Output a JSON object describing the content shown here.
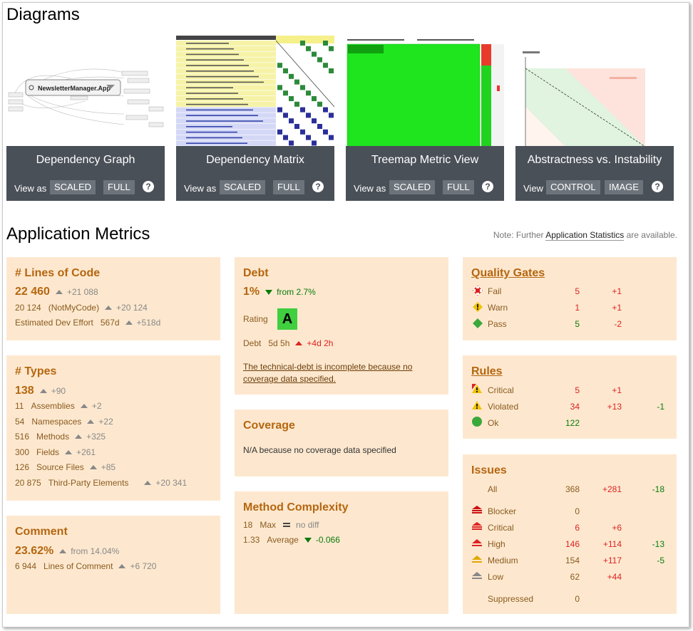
{
  "sections": {
    "diagrams_title": "Diagrams",
    "metrics_title": "Application Metrics"
  },
  "note": {
    "prefix": "Note: Further ",
    "link": "Application Statistics",
    "suffix": " are available."
  },
  "diagrams": [
    {
      "title": "Dependency Graph",
      "view_label": "View as",
      "btn1": "SCALED",
      "btn2": "FULL",
      "help": "?",
      "thumb_label": "NewsletterManager.App"
    },
    {
      "title": "Dependency Matrix",
      "view_label": "View as",
      "btn1": "SCALED",
      "btn2": "FULL",
      "help": "?"
    },
    {
      "title": "Treemap Metric View",
      "view_label": "View as",
      "btn1": "SCALED",
      "btn2": "FULL",
      "help": "?"
    },
    {
      "title": "Abstractness vs. Instability",
      "view_label": "View",
      "btn1": "CONTROL",
      "btn2": "IMAGE",
      "help": "?"
    }
  ],
  "loc": {
    "title": "# Lines of Code",
    "value": "22 460",
    "delta": "+21 088",
    "notmycode_value": "20 124",
    "notmycode_label": "(NotMyCode)",
    "notmycode_delta": "+20 124",
    "effort_label": "Estimated Dev Effort",
    "effort_value": "567d",
    "effort_delta": "+518d"
  },
  "types": {
    "title": "# Types",
    "value": "138",
    "delta": "+90",
    "rows": [
      {
        "value": "11",
        "label": "Assemblies",
        "delta": "+2"
      },
      {
        "value": "54",
        "label": "Namespaces",
        "delta": "+22"
      },
      {
        "value": "516",
        "label": "Methods",
        "delta": "+325"
      },
      {
        "value": "300",
        "label": "Fields",
        "delta": "+261"
      },
      {
        "value": "126",
        "label": "Source Files",
        "delta": "+85"
      },
      {
        "value": "20 875",
        "label": "Third-Party Elements",
        "delta": "+20 341"
      }
    ]
  },
  "comment": {
    "title": "Comment",
    "value": "23.62%",
    "from": "from 14.04%",
    "lines_value": "6 944",
    "lines_label": "Lines of Comment",
    "lines_delta": "+6 720"
  },
  "debt": {
    "title": "Debt",
    "value": "1%",
    "from": "from 2.7%",
    "rating_label": "Rating",
    "rating": "A",
    "debt_label": "Debt",
    "debt_value": "5d 5h",
    "debt_delta": "+4d 2h",
    "warning": "The technical-debt is incomplete because no coverage data specified."
  },
  "coverage": {
    "title": "Coverage",
    "text": "N/A because no coverage data specified"
  },
  "complexity": {
    "title": "Method Complexity",
    "max_value": "18",
    "max_label": "Max",
    "max_delta": "no diff",
    "avg_value": "1.33",
    "avg_label": "Average",
    "avg_delta": "-0.066"
  },
  "quality_gates": {
    "title": "Quality Gates",
    "rows": [
      {
        "label": "Fail",
        "value": "5",
        "delta": "+1"
      },
      {
        "label": "Warn",
        "value": "1",
        "delta": "+1"
      },
      {
        "label": "Pass",
        "value": "5",
        "delta": "-2"
      }
    ]
  },
  "rules": {
    "title": "Rules",
    "rows": [
      {
        "label": "Critical",
        "value": "5",
        "delta": "+1",
        "delta2": ""
      },
      {
        "label": "Violated",
        "value": "34",
        "delta": "+13",
        "delta2": "-1"
      },
      {
        "label": "Ok",
        "value": "122",
        "delta": "",
        "delta2": ""
      }
    ]
  },
  "issues": {
    "title": "Issues",
    "all": {
      "label": "All",
      "value": "368",
      "delta": "+281",
      "delta2": "-18"
    },
    "rows": [
      {
        "label": "Blocker",
        "value": "0",
        "delta": "",
        "delta2": ""
      },
      {
        "label": "Critical",
        "value": "6",
        "delta": "+6",
        "delta2": ""
      },
      {
        "label": "High",
        "value": "146",
        "delta": "+114",
        "delta2": "-13"
      },
      {
        "label": "Medium",
        "value": "154",
        "delta": "+117",
        "delta2": "-5"
      },
      {
        "label": "Low",
        "value": "62",
        "delta": "+44",
        "delta2": ""
      }
    ],
    "suppressed": {
      "label": "Suppressed",
      "value": "0"
    }
  },
  "colors": {
    "accent": "#b5660f",
    "card_bg": "#fde8cf",
    "bar_bg": "#4a5058",
    "up_red": "#dd2222",
    "good_green": "#0a7a0a",
    "rating_green": "#3fcf3f"
  }
}
